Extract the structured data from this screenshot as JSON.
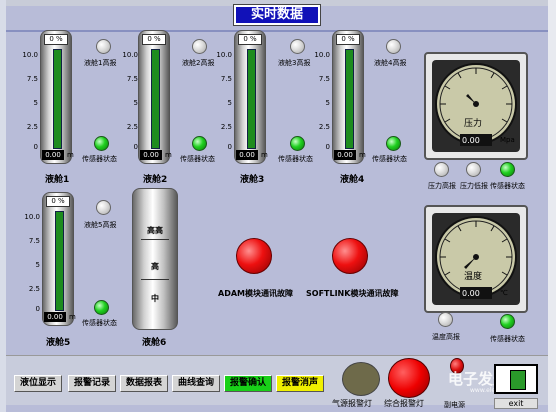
{
  "title": "实时数据",
  "tanks": [
    {
      "id": "t1",
      "top_reading": "0 %",
      "bottom_reading": "0.00",
      "unit": "m",
      "label": "液舱1",
      "alarm_label": "液舱1高报",
      "sensor_label": "传感器状态"
    },
    {
      "id": "t2",
      "top_reading": "0 %",
      "bottom_reading": "0.00",
      "unit": "m",
      "label": "液舱2",
      "alarm_label": "液舱2高报",
      "sensor_label": "传感器状态"
    },
    {
      "id": "t3",
      "top_reading": "0 %",
      "bottom_reading": "0.00",
      "unit": "m",
      "label": "液舱3",
      "alarm_label": "液舱3高报",
      "sensor_label": "传感器状态"
    },
    {
      "id": "t4",
      "top_reading": "0 %",
      "bottom_reading": "0.00",
      "unit": "m",
      "label": "液舱4",
      "alarm_label": "液舱4高报",
      "sensor_label": "传感器状态"
    },
    {
      "id": "t5",
      "top_reading": "0 %",
      "bottom_reading": "0.00",
      "unit": "m",
      "label": "液舱5",
      "alarm_label": "液舱5高报",
      "sensor_label": "传感器状态"
    }
  ],
  "scale_ticks": [
    "10.0",
    "7.5",
    "5",
    "2.5",
    "0"
  ],
  "tank6": {
    "label": "液舱6",
    "levels": [
      "高高",
      "高",
      "中"
    ]
  },
  "pressure_gauge": {
    "name": "压力",
    "reading": "0.00",
    "unit": "Mpa",
    "alarm_high": "压力高报",
    "alarm_low": "压力低报",
    "sensor_label": "传感器状态"
  },
  "temp_gauge": {
    "name": "温度",
    "reading": "0.00",
    "unit": "℃",
    "alarm_high": "温度高报",
    "sensor_label": "传感器状态"
  },
  "comm_faults": {
    "adam": "ADAM模块通讯故障",
    "softlink": "SOFTLINK模块通讯故障"
  },
  "buttons": {
    "level_display": "液位显示",
    "alarm_record": "报警记录",
    "data_report": "数据报表",
    "curve_query": "曲线查询",
    "alarm_confirm": "报警确认",
    "alarm_silence": "报警消声"
  },
  "indicators": {
    "source_alarm_lamp": "气源报警灯",
    "general_alarm_lamp": "综合报警灯",
    "backup_source": "副电源"
  },
  "exit_label": "exit",
  "watermark": "电子发烧友",
  "watermark_sub": "www.elecfans.com",
  "colors": {
    "title_bg": "#1111b8",
    "bar_green": "#1e8c1e",
    "lamp_green": "#20d020",
    "lamp_red": "#ee1010",
    "confirm_green": "#18d018",
    "silence_yellow": "#f0f000"
  }
}
